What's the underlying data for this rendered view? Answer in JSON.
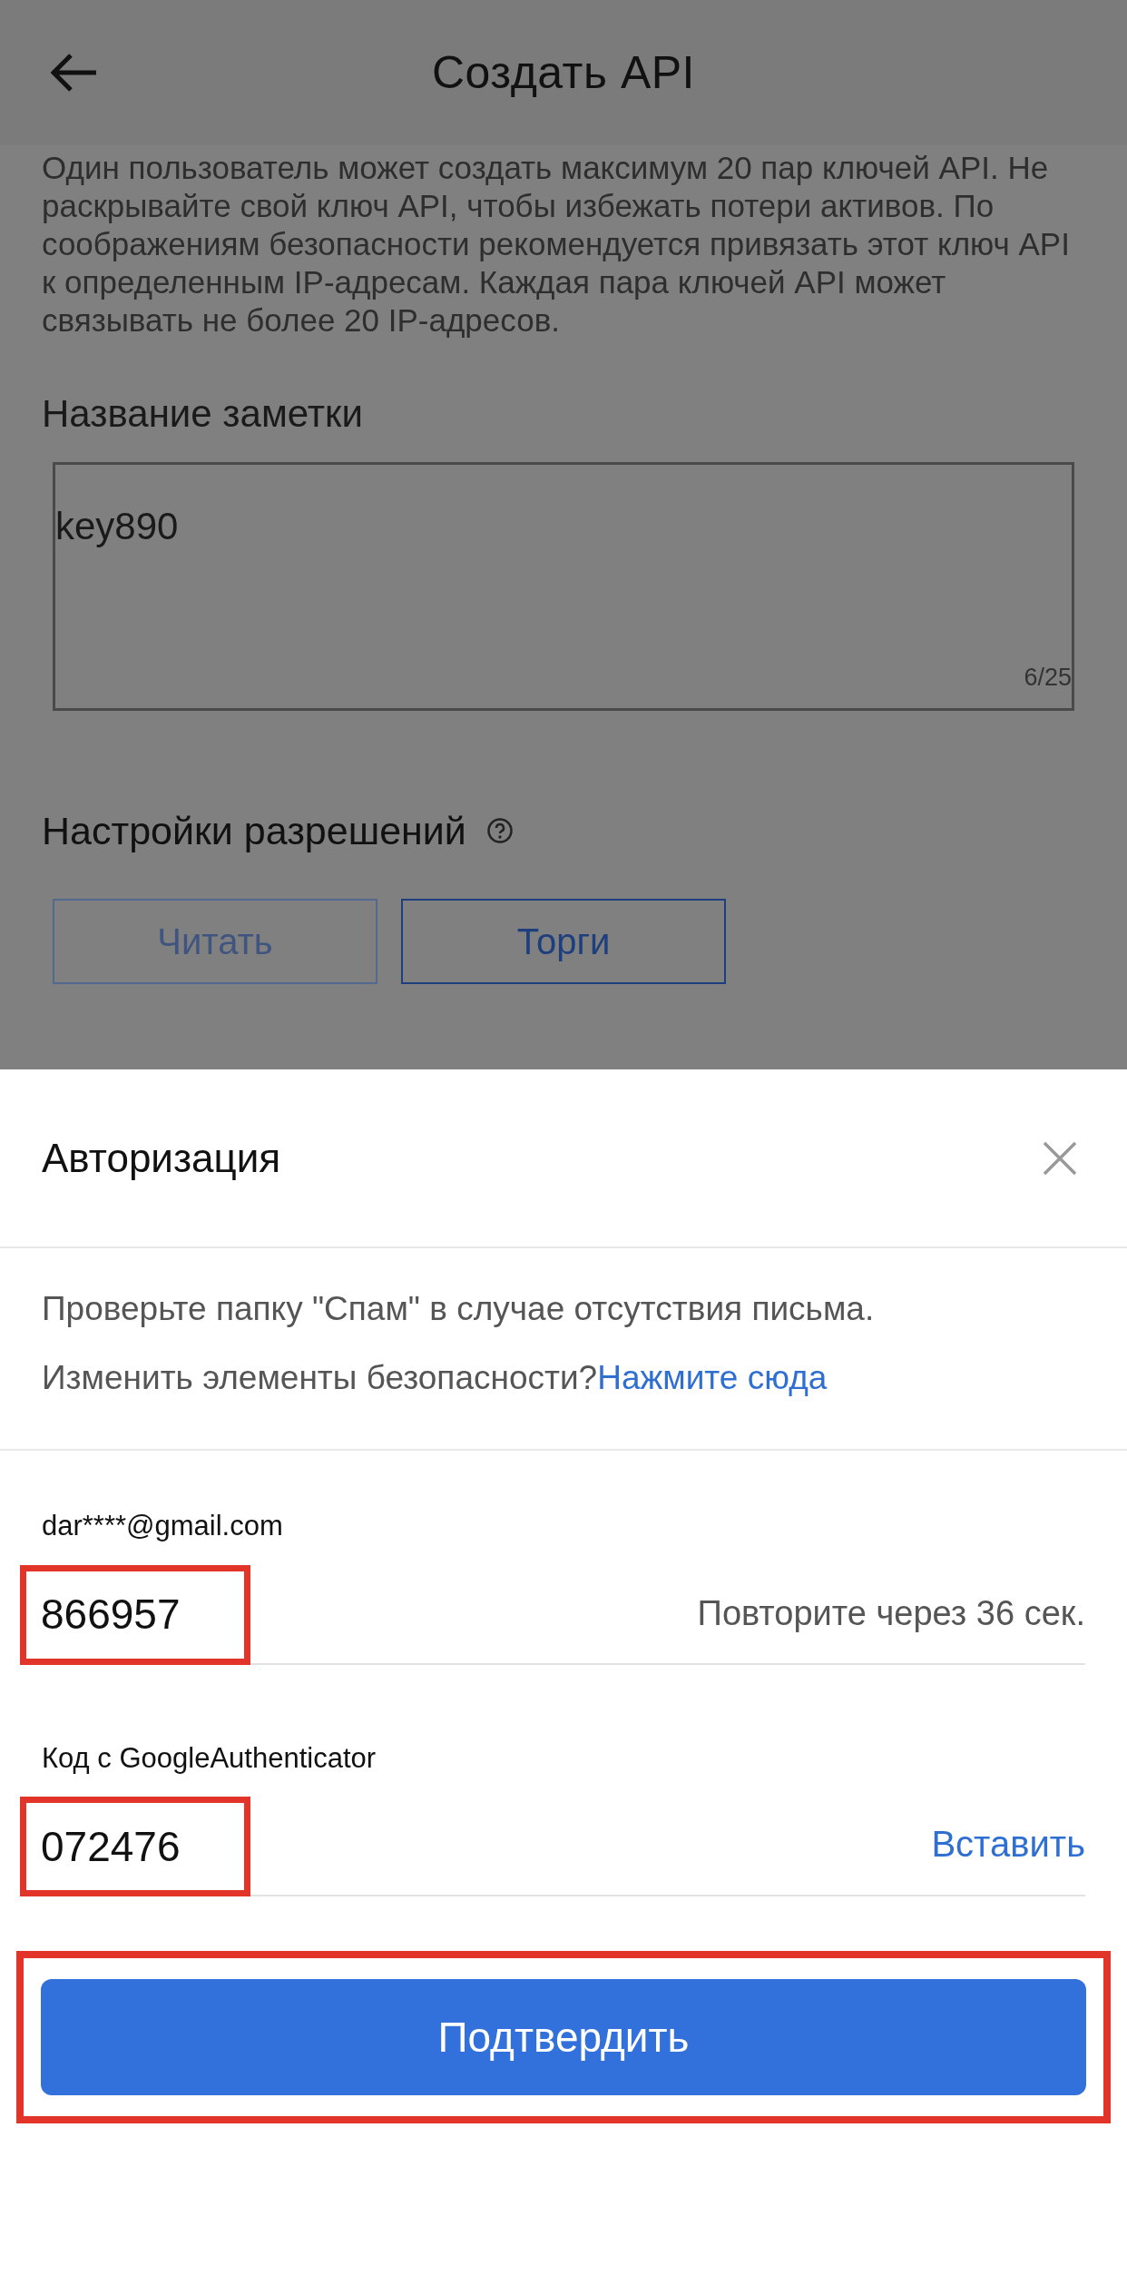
{
  "header": {
    "title": "Создать API"
  },
  "notice": "Один пользователь может создать максимум 20 пар ключей API. Не раскрывайте свой ключ API, чтобы избежать потери активов. По соображениям безопасности рекомендуется привязать этот ключ API к определенным IP-адресам. Каждая пара ключей API может связывать не более 20 IP-адресов.",
  "note_name": {
    "label": "Название заметки",
    "value": "key890",
    "counter": "6/25"
  },
  "permissions": {
    "title": "Настройки разрешений",
    "options": [
      {
        "label": "Читать",
        "selected": false
      },
      {
        "label": "Торги",
        "selected": true
      }
    ]
  },
  "auth_sheet": {
    "title": "Авторизация",
    "spam_hint": "Проверьте папку \"Спам\" в случае отсутствия письма.",
    "security_question": "Изменить элементы безопасности?",
    "security_link": "Нажмите сюда",
    "fields": [
      {
        "label": "dar****@gmail.com",
        "value": "866957",
        "action": "Повторите через 36 сек.",
        "kind": "timer",
        "highlighted": true
      },
      {
        "label": "Код с GoogleAuthenticator",
        "value": "072476",
        "action": "Вставить",
        "kind": "link",
        "highlighted": true
      }
    ],
    "confirm": {
      "label": "Подтвердить",
      "highlighted": true
    }
  }
}
